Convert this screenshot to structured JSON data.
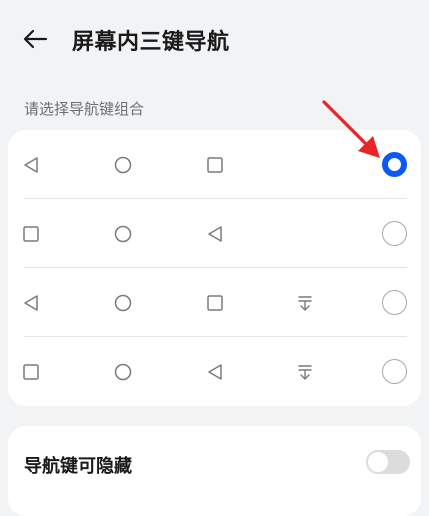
{
  "header": {
    "title": "屏幕内三键导航",
    "back_icon": "arrow-left-icon"
  },
  "section": {
    "label": "请选择导航键组合"
  },
  "options": [
    {
      "icons": [
        "back-triangle-icon",
        "home-circle-icon",
        "recent-square-icon"
      ],
      "selected": true
    },
    {
      "icons": [
        "recent-square-icon",
        "home-circle-icon",
        "back-triangle-icon"
      ],
      "selected": false
    },
    {
      "icons": [
        "back-triangle-icon",
        "home-circle-icon",
        "recent-square-icon",
        "notification-pulldown-icon"
      ],
      "selected": false
    },
    {
      "icons": [
        "recent-square-icon",
        "home-circle-icon",
        "back-triangle-icon",
        "notification-pulldown-icon"
      ],
      "selected": false
    }
  ],
  "toggle": {
    "label": "导航键可隐藏",
    "on": false
  },
  "colors": {
    "accent": "#0a59f7",
    "annotation": "#e8232a"
  }
}
